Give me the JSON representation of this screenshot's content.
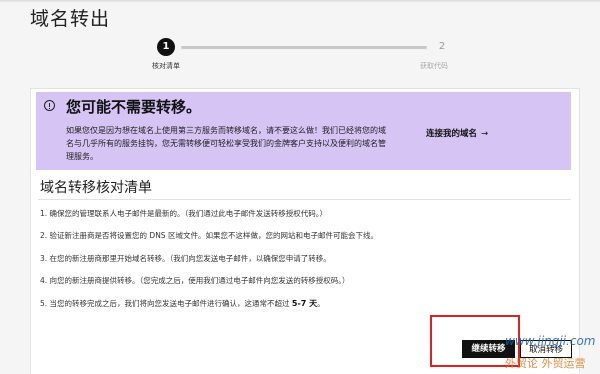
{
  "page": {
    "title": "域名转出"
  },
  "stepper": {
    "steps": [
      {
        "number": "1",
        "label": "核对清单"
      },
      {
        "number": "2",
        "label": "获取代码"
      }
    ]
  },
  "notice": {
    "title": "您可能不需要转移。",
    "body": "如果您仅是因为想在域名上使用第三方服务而转移域名，请不要这么做！我们已经将您的域名与几乎所有的服务挂钩，您无需转移便可轻松享受我们的金牌客户支持以及便利的域名管理服务。",
    "link_label": "连接我的域名",
    "link_arrow": "→"
  },
  "checklist": {
    "title": "域名转移核对清单",
    "items": [
      "1. 确保您的管理联系人电子邮件是最新的。（我们通过此电子邮件发送转移授权代码。）",
      "2. 验证新注册商是否将设置您的 DNS 区域文件。如果您不这样做，您的网站和电子邮件可能会下线。",
      "3. 在您的新注册商那里开始域名转移。（我们向您发送电子邮件，以确保您申请了转移。",
      "4. 向您的新注册商提供转移。（您完成之后，使用我们通过电子邮件向您发送的转移授权码。）"
    ],
    "last_item_prefix": "5. 当您的转移完成之后，我们将向您发送电子邮件进行确认，这通常不超过 ",
    "last_item_bold": "5-7 天",
    "last_item_suffix": "。"
  },
  "buttons": {
    "continue": "继续转移",
    "cancel": "取消转移"
  },
  "watermark": {
    "line1": "www.jingji.com",
    "line2": "外贸论 外贸运营"
  },
  "colors": {
    "notice_bg": "#d5c4f4",
    "primary_button": "#111111",
    "highlight": "#e02020"
  }
}
